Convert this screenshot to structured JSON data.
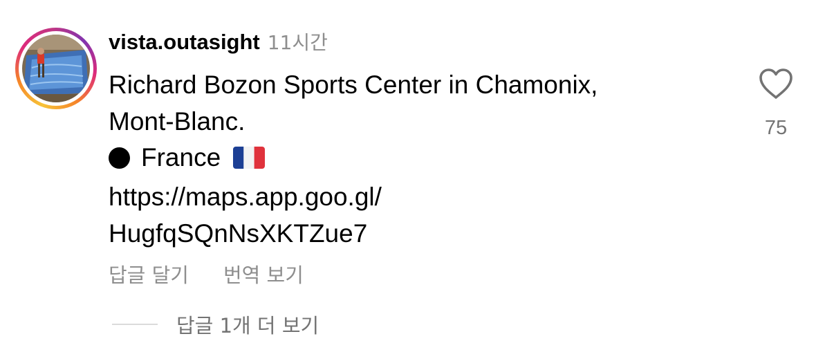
{
  "comment": {
    "username": "vista.outasight",
    "timestamp": "11시간",
    "text_lines": [
      "Richard Bozon Sports Center in Chamonix,",
      "Mont-Blanc."
    ],
    "location": {
      "name": "France",
      "bullet_icon": "black-circle-icon",
      "flag_icon": "france-flag-icon"
    },
    "link_lines": [
      "https://maps.app.goo.gl/",
      "HugfqSQnNsXKTZue7"
    ],
    "actions": {
      "reply_label": "답글 달기",
      "translate_label": "번역 보기"
    },
    "replies_label": "답글 1개 더 보기",
    "like": {
      "icon": "heart-outline-icon",
      "count": "75"
    }
  },
  "colors": {
    "text_primary": "#000000",
    "text_secondary": "#8e8e8e",
    "story_ring": [
      "#f7c338",
      "#f58529",
      "#dd2a7b",
      "#8134af"
    ],
    "divider": "#dbdbdb"
  }
}
